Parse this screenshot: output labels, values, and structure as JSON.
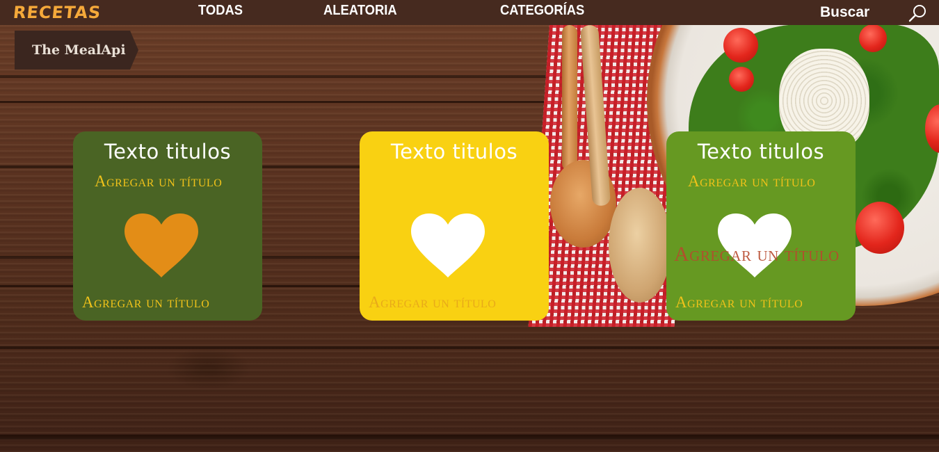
{
  "navbar": {
    "brand": "RECETAS",
    "links": [
      "TODAS",
      "ALEATORIA",
      "CATEGORÍAS"
    ],
    "search_label": "Buscar",
    "search_icon": "search-icon"
  },
  "tag": {
    "label": "The MealApi"
  },
  "cards": [
    {
      "title": "Texto titulos",
      "subtitle": "Agregar un título",
      "footer": "Agregar un título",
      "heart_icon": "heart-icon",
      "bg_color": "#4a6424",
      "heart_color": "#e38d17",
      "text_color": "#f0c21a"
    },
    {
      "title": "Texto titulos",
      "footer": "Agregar un título",
      "heart_icon": "heart-icon",
      "bg_color": "#f9d112",
      "heart_color": "#ffffff",
      "text_color": "#e8a91a"
    },
    {
      "title": "Texto titulos",
      "subtitle": "Agregar un título",
      "footer": "Agregar un título",
      "overlay": "Agregar un título",
      "heart_icon": "heart-icon",
      "bg_color": "#669922",
      "heart_color": "#ffffff",
      "text_color": "#f0c21a"
    }
  ],
  "colors": {
    "navbar_bg": "#462a1f",
    "brand": "#f5a93a",
    "tag_bg": "#3b261f"
  }
}
